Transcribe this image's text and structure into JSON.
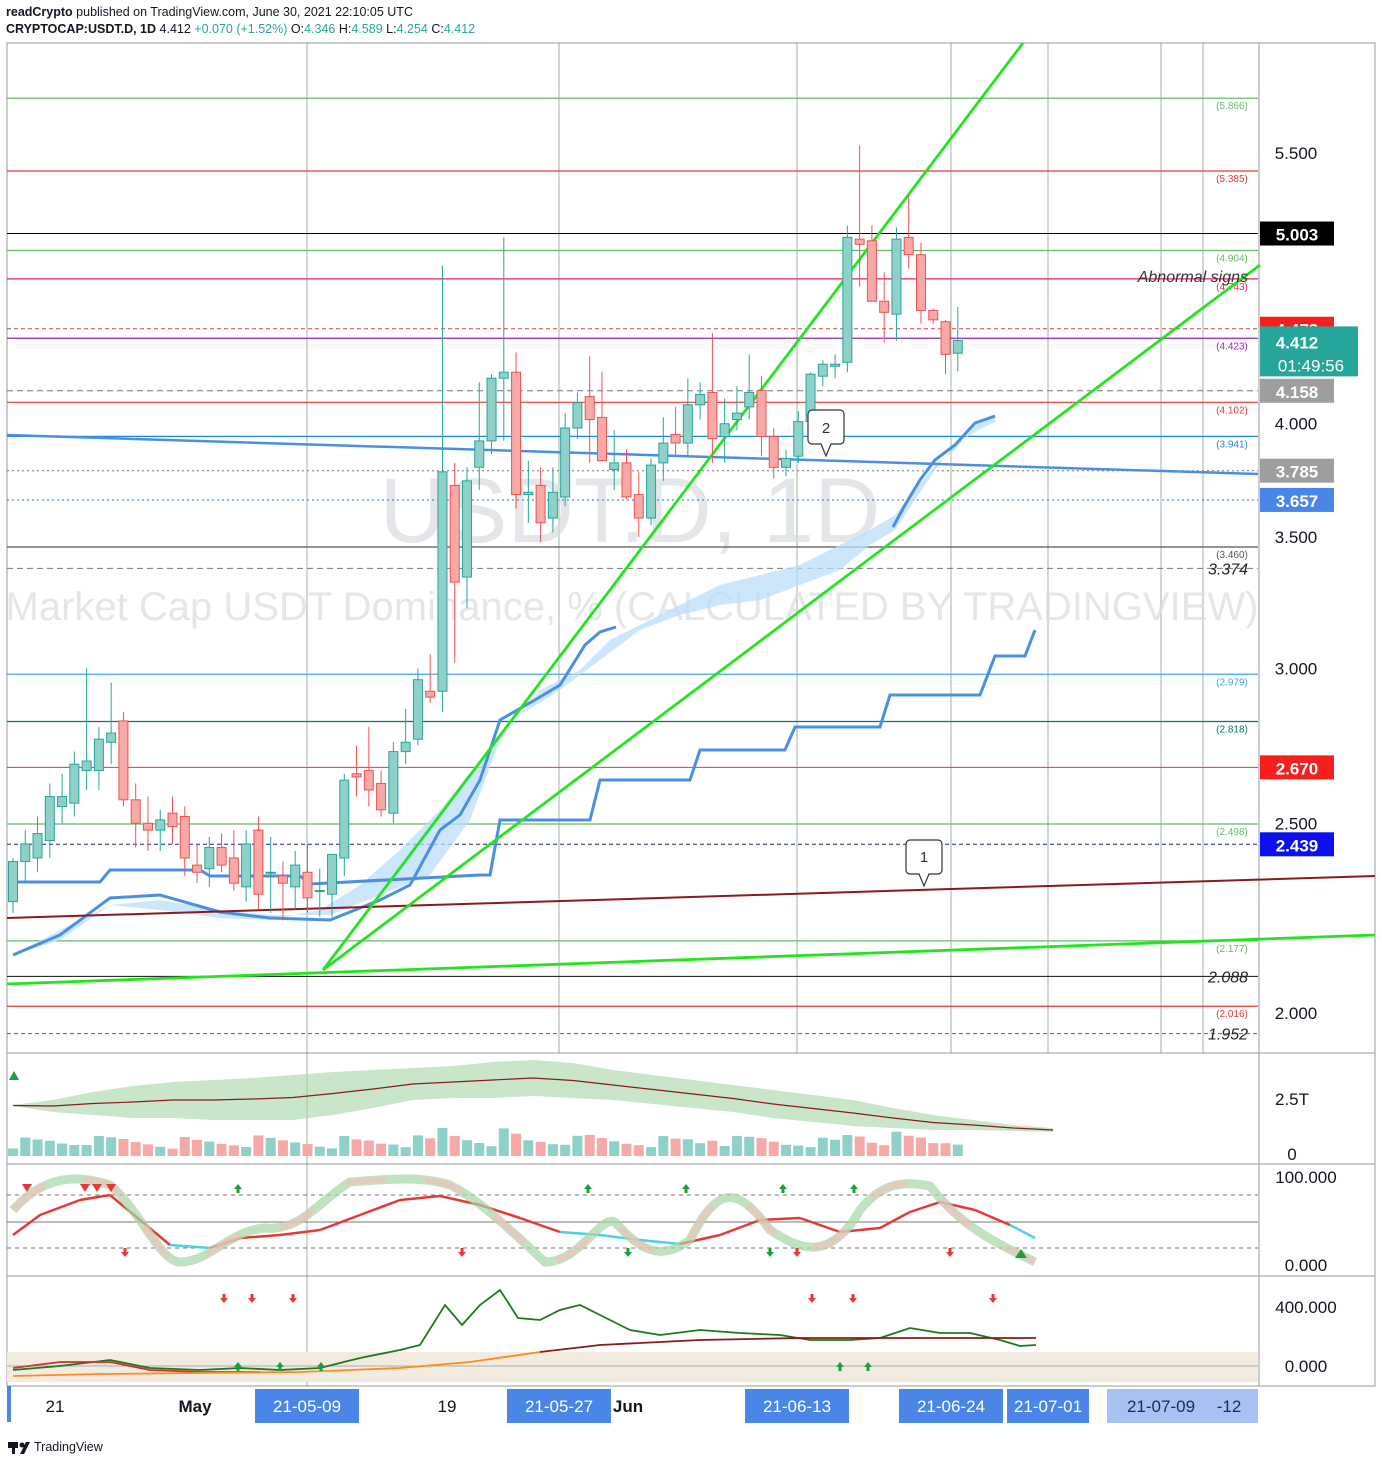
{
  "header": {
    "publisher": "readCrypto",
    "published_text": "published on TradingView.com, June 30, 2021 22:10:05 UTC",
    "symbol": "CRYPTOCAP:USDT.D, 1D",
    "last": "4.412",
    "change": "+0.070 (+1.52%)",
    "o_label": "O:",
    "o": "4.346",
    "h_label": "H:",
    "h": "4.589",
    "l_label": "L:",
    "l": "4.254",
    "c_label": "C:",
    "c": "4.412"
  },
  "watermark": {
    "symbol": "USDT.D, 1D",
    "description": "Market Cap USDT Dominance, % (CALCULATED BY TRADINGVIEW)"
  },
  "footer": {
    "brand": "TradingView"
  },
  "colors": {
    "up": "#26a69a",
    "down": "#ef5350",
    "ribbon_blue": "#4a90e2",
    "trend_green": "#22e51e",
    "cloud": "#bbdefb",
    "date_tag": "#4a86e8"
  },
  "chart_data": {
    "type": "candlestick",
    "symbol": "CRYPTOCAP:USDT.D",
    "timeframe": "1D",
    "y_axis": {
      "scale": "log",
      "ylim": [
        1.82,
        6.05
      ],
      "tick_labels": [
        "5.500",
        "5.003",
        "4.000",
        "3.500",
        "3.000",
        "2.500",
        "2.000"
      ]
    },
    "candles": [
      {
        "o": 2.28,
        "h": 2.4,
        "l": 2.25,
        "c": 2.39
      },
      {
        "o": 2.39,
        "h": 2.48,
        "l": 2.33,
        "c": 2.44
      },
      {
        "o": 2.4,
        "h": 2.52,
        "l": 2.36,
        "c": 2.47
      },
      {
        "o": 2.45,
        "h": 2.62,
        "l": 2.4,
        "c": 2.58
      },
      {
        "o": 2.55,
        "h": 2.65,
        "l": 2.5,
        "c": 2.58
      },
      {
        "o": 2.56,
        "h": 2.72,
        "l": 2.52,
        "c": 2.68
      },
      {
        "o": 2.66,
        "h": 3.0,
        "l": 2.6,
        "c": 2.69
      },
      {
        "o": 2.66,
        "h": 2.8,
        "l": 2.6,
        "c": 2.76
      },
      {
        "o": 2.75,
        "h": 2.95,
        "l": 2.68,
        "c": 2.78
      },
      {
        "o": 2.82,
        "h": 2.85,
        "l": 2.55,
        "c": 2.57
      },
      {
        "o": 2.57,
        "h": 2.62,
        "l": 2.43,
        "c": 2.5
      },
      {
        "o": 2.5,
        "h": 2.58,
        "l": 2.42,
        "c": 2.48
      },
      {
        "o": 2.48,
        "h": 2.54,
        "l": 2.42,
        "c": 2.51
      },
      {
        "o": 2.53,
        "h": 2.58,
        "l": 2.44,
        "c": 2.49
      },
      {
        "o": 2.52,
        "h": 2.55,
        "l": 2.35,
        "c": 2.4
      },
      {
        "o": 2.38,
        "h": 2.44,
        "l": 2.33,
        "c": 2.36
      },
      {
        "o": 2.37,
        "h": 2.46,
        "l": 2.32,
        "c": 2.43
      },
      {
        "o": 2.43,
        "h": 2.47,
        "l": 2.36,
        "c": 2.38
      },
      {
        "o": 2.4,
        "h": 2.48,
        "l": 2.31,
        "c": 2.33
      },
      {
        "o": 2.32,
        "h": 2.48,
        "l": 2.28,
        "c": 2.44
      },
      {
        "o": 2.48,
        "h": 2.52,
        "l": 2.26,
        "c": 2.3
      },
      {
        "o": 2.36,
        "h": 2.46,
        "l": 2.25,
        "c": 2.36
      },
      {
        "o": 2.35,
        "h": 2.39,
        "l": 2.23,
        "c": 2.33
      },
      {
        "o": 2.32,
        "h": 2.42,
        "l": 2.26,
        "c": 2.38
      },
      {
        "o": 2.36,
        "h": 2.44,
        "l": 2.25,
        "c": 2.29
      },
      {
        "o": 2.31,
        "h": 2.37,
        "l": 2.24,
        "c": 2.31
      },
      {
        "o": 2.3,
        "h": 2.4,
        "l": 2.24,
        "c": 2.41
      },
      {
        "o": 2.4,
        "h": 2.65,
        "l": 2.35,
        "c": 2.63
      },
      {
        "o": 2.65,
        "h": 2.74,
        "l": 2.58,
        "c": 2.64
      },
      {
        "o": 2.66,
        "h": 2.8,
        "l": 2.55,
        "c": 2.6
      },
      {
        "o": 2.62,
        "h": 2.66,
        "l": 2.52,
        "c": 2.54
      },
      {
        "o": 2.53,
        "h": 2.75,
        "l": 2.5,
        "c": 2.72
      },
      {
        "o": 2.72,
        "h": 2.86,
        "l": 2.68,
        "c": 2.75
      },
      {
        "o": 2.76,
        "h": 3.0,
        "l": 2.74,
        "c": 2.96
      },
      {
        "o": 2.92,
        "h": 3.05,
        "l": 2.88,
        "c": 2.9
      },
      {
        "o": 2.92,
        "h": 4.82,
        "l": 2.85,
        "c": 3.78
      },
      {
        "o": 3.72,
        "h": 3.82,
        "l": 3.02,
        "c": 3.32
      },
      {
        "o": 3.34,
        "h": 3.8,
        "l": 3.22,
        "c": 3.74
      },
      {
        "o": 3.8,
        "h": 4.2,
        "l": 3.7,
        "c": 3.92
      },
      {
        "o": 3.92,
        "h": 4.24,
        "l": 3.86,
        "c": 4.22
      },
      {
        "o": 4.22,
        "h": 4.98,
        "l": 3.92,
        "c": 4.25
      },
      {
        "o": 4.25,
        "h": 4.35,
        "l": 3.62,
        "c": 3.68
      },
      {
        "o": 3.68,
        "h": 3.83,
        "l": 3.56,
        "c": 3.69
      },
      {
        "o": 3.72,
        "h": 3.8,
        "l": 3.48,
        "c": 3.56
      },
      {
        "o": 3.58,
        "h": 3.8,
        "l": 3.52,
        "c": 3.69
      },
      {
        "o": 3.67,
        "h": 4.05,
        "l": 3.63,
        "c": 3.98
      },
      {
        "o": 3.98,
        "h": 4.15,
        "l": 3.93,
        "c": 4.1
      },
      {
        "o": 4.13,
        "h": 4.33,
        "l": 3.82,
        "c": 4.02
      },
      {
        "o": 4.03,
        "h": 4.25,
        "l": 3.86,
        "c": 3.83
      },
      {
        "o": 3.79,
        "h": 3.97,
        "l": 3.7,
        "c": 3.82
      },
      {
        "o": 3.82,
        "h": 3.88,
        "l": 3.66,
        "c": 3.67
      },
      {
        "o": 3.68,
        "h": 3.78,
        "l": 3.5,
        "c": 3.58
      },
      {
        "o": 3.58,
        "h": 3.84,
        "l": 3.55,
        "c": 3.81
      },
      {
        "o": 3.82,
        "h": 4.03,
        "l": 3.74,
        "c": 3.91
      },
      {
        "o": 3.95,
        "h": 4.08,
        "l": 3.85,
        "c": 3.91
      },
      {
        "o": 3.91,
        "h": 4.22,
        "l": 3.85,
        "c": 4.09
      },
      {
        "o": 4.09,
        "h": 4.2,
        "l": 4.02,
        "c": 4.14
      },
      {
        "o": 4.15,
        "h": 4.45,
        "l": 3.82,
        "c": 3.93
      },
      {
        "o": 3.94,
        "h": 4.12,
        "l": 3.82,
        "c": 4.0
      },
      {
        "o": 4.02,
        "h": 4.18,
        "l": 3.97,
        "c": 4.05
      },
      {
        "o": 4.08,
        "h": 4.34,
        "l": 4.02,
        "c": 4.15
      },
      {
        "o": 4.16,
        "h": 4.23,
        "l": 3.85,
        "c": 3.94
      },
      {
        "o": 3.94,
        "h": 3.98,
        "l": 3.75,
        "c": 3.8
      },
      {
        "o": 3.8,
        "h": 3.88,
        "l": 3.76,
        "c": 3.84
      },
      {
        "o": 3.85,
        "h": 4.06,
        "l": 3.82,
        "c": 4.01
      },
      {
        "o": 4.01,
        "h": 4.25,
        "l": 3.96,
        "c": 4.24
      },
      {
        "o": 4.23,
        "h": 4.31,
        "l": 4.18,
        "c": 4.29
      },
      {
        "o": 4.28,
        "h": 4.34,
        "l": 4.22,
        "c": 4.29
      },
      {
        "o": 4.3,
        "h": 5.05,
        "l": 4.25,
        "c": 4.98
      },
      {
        "o": 4.97,
        "h": 5.55,
        "l": 4.7,
        "c": 4.94
      },
      {
        "o": 4.96,
        "h": 5.05,
        "l": 4.62,
        "c": 4.62
      },
      {
        "o": 4.62,
        "h": 4.78,
        "l": 4.4,
        "c": 4.56
      },
      {
        "o": 4.55,
        "h": 5.04,
        "l": 4.41,
        "c": 4.97
      },
      {
        "o": 4.98,
        "h": 5.23,
        "l": 4.8,
        "c": 4.88
      },
      {
        "o": 4.88,
        "h": 4.95,
        "l": 4.5,
        "c": 4.57
      },
      {
        "o": 4.57,
        "h": 4.58,
        "l": 4.5,
        "c": 4.52
      },
      {
        "o": 4.51,
        "h": 4.52,
        "l": 4.24,
        "c": 4.34
      },
      {
        "o": 4.346,
        "h": 4.589,
        "l": 4.254,
        "c": 4.412
      }
    ],
    "horizontal_levels": [
      {
        "value": "5.866",
        "color": "#66bb6a"
      },
      {
        "value": "5.385",
        "color": "#e53935"
      },
      {
        "value": "4.904",
        "color": "#66bb6a"
      },
      {
        "value": "4.743",
        "color": "#e91e63"
      },
      {
        "value": "4.423",
        "color": "#9c27b0"
      },
      {
        "value": "4.102",
        "color": "#e53935"
      },
      {
        "value": "3.941",
        "color": "#1e88e5"
      },
      {
        "value": "3.460",
        "color": "#555555"
      },
      {
        "value": "2.979",
        "color": "#42a5f5"
      },
      {
        "value": "2.818",
        "color": "#00796b"
      },
      {
        "value": "2.498",
        "color": "#66bb6a"
      },
      {
        "value": "2.177",
        "color": "#66bb6a"
      },
      {
        "value": "2.016",
        "color": "#e53935"
      }
    ],
    "dashed_levels": [
      "5.003",
      "4.473",
      "4.158",
      "3.785",
      "3.657",
      "3.374",
      "2.670",
      "2.439",
      "2.088",
      "1.952"
    ],
    "price_tags": [
      {
        "value": "5.003",
        "bg": "#000000"
      },
      {
        "value": "4.473",
        "bg": "#f71e1e"
      },
      {
        "value": "4.158",
        "bg": "#9e9e9e"
      },
      {
        "value": "3.785",
        "bg": "#9e9e9e"
      },
      {
        "value": "3.657",
        "bg": "#4a86e8"
      },
      {
        "value": "2.670",
        "bg": "#f71e1e"
      },
      {
        "value": "2.439",
        "bg": "#0d10ee"
      }
    ],
    "current_price": {
      "value": "4.412",
      "countdown": "01:49:56",
      "bg": "#26a69a"
    },
    "plain_axis_labels": [
      "3.374",
      "2.088",
      "1.952"
    ],
    "annotations": {
      "abnormal": "Abnormal signs",
      "callout1": "1",
      "callout2": "2"
    },
    "x_labels": [
      {
        "text": "21",
        "tag": false
      },
      {
        "text": "May",
        "tag": false
      },
      {
        "text": "21-05-09",
        "tag": true
      },
      {
        "text": "19",
        "tag": false
      },
      {
        "text": "21-05-27",
        "tag": true
      },
      {
        "text": "Jun",
        "tag": false
      },
      {
        "text": "21-06-13",
        "tag": true
      },
      {
        "text": "21-06-24",
        "tag": true
      },
      {
        "text": "21-07-01",
        "tag": true
      },
      {
        "text": "21-07-09",
        "tag": true
      },
      {
        "text": "-12",
        "tag": true
      }
    ],
    "panes": [
      {
        "name": "volume",
        "ticks": [
          "2.5T",
          "0"
        ]
      },
      {
        "name": "oscillator",
        "ticks": [
          "100.000",
          "0.000"
        ]
      },
      {
        "name": "trend-strength",
        "ticks": [
          "400.000",
          "0.000"
        ]
      }
    ]
  }
}
